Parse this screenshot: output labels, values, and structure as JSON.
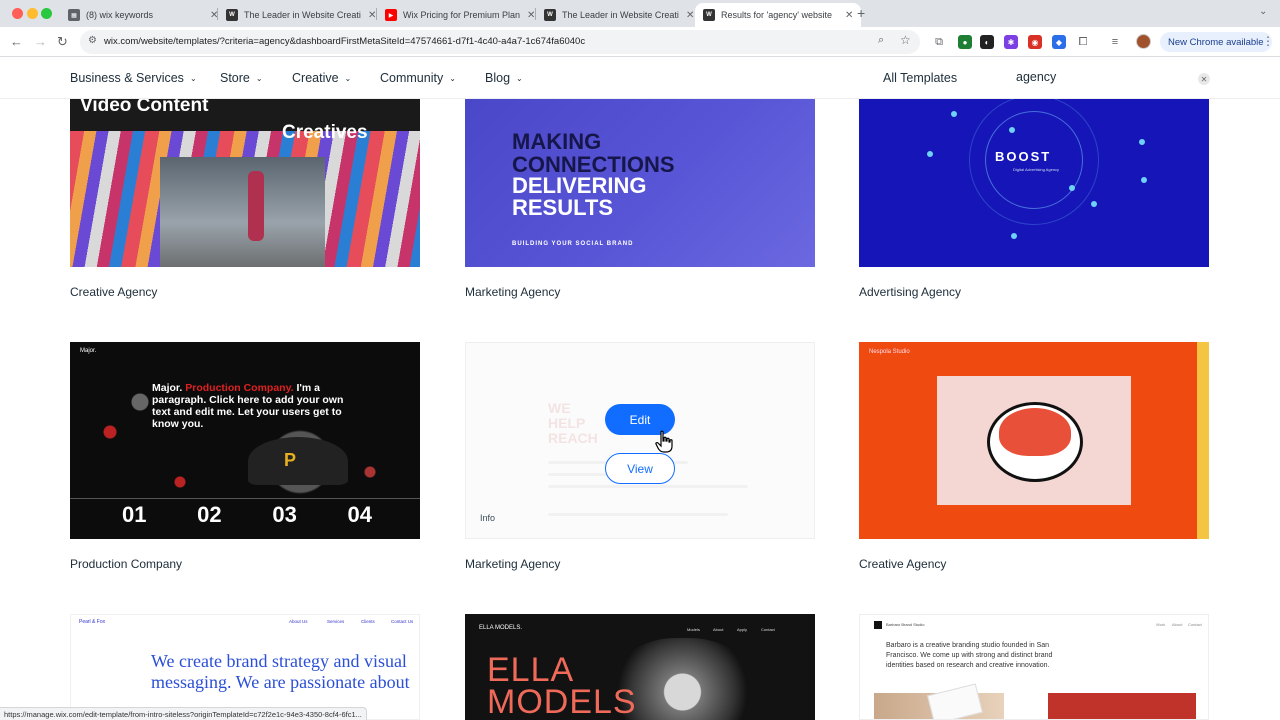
{
  "browser": {
    "tabs": [
      {
        "label": "(8) wix keywords",
        "favicon": "wix-doc-icon"
      },
      {
        "label": "The Leader in Website Creati",
        "favicon": "wix-icon"
      },
      {
        "label": "Wix Pricing for Premium Plan",
        "favicon": "youtube-icon"
      },
      {
        "label": "The Leader in Website Creati",
        "favicon": "wix-icon"
      },
      {
        "label": "Results for 'agency' website",
        "favicon": "wix-icon",
        "active": true
      }
    ],
    "url": "wix.com/website/templates/?criteria=agency&dashboardFirstMetaSiteId=47574661-d7f1-4c40-a4a7-1c674fa6040c",
    "update_label": "New Chrome available",
    "status_url": "https://manage.wix.com/edit-template/from-intro-siteless?originTemplateId=c72f2e1c-94e3-4350-8cf4-6fc1..."
  },
  "nav": {
    "items": [
      {
        "label": "Business & Services"
      },
      {
        "label": "Store"
      },
      {
        "label": "Creative"
      },
      {
        "label": "Community"
      },
      {
        "label": "Blog"
      }
    ],
    "all_templates": "All Templates",
    "search_value": "agency"
  },
  "templates": [
    {
      "title": "Creative Agency",
      "thumb": {
        "line1": "Video Content",
        "line2": "Creatives"
      }
    },
    {
      "title": "Marketing Agency",
      "thumb": {
        "line1": "MAKING",
        "line2": "CONNECTIONS",
        "line3": "DELIVERING",
        "line4": "RESULTS",
        "sub": "BUILDING YOUR SOCIAL BRAND"
      }
    },
    {
      "title": "Advertising Agency",
      "thumb": {
        "logo": "BOOST",
        "sub": "Digital Advertising Agency"
      }
    },
    {
      "title": "Production Company",
      "thumb": {
        "brand": "Major.",
        "para_lead": "Major.",
        "para_red": "Production Company.",
        "para_rest": "I'm a paragraph. Click here to add your own text and edit me. Let your users get to know you.",
        "nums": [
          "01",
          "02",
          "03",
          "04"
        ]
      }
    },
    {
      "title": "Marketing Agency",
      "hover": {
        "edit": "Edit",
        "view": "View",
        "info": "Info"
      }
    },
    {
      "title": "Creative Agency",
      "thumb": {
        "brand": "Nespola Studio"
      }
    },
    {
      "thumb": {
        "brand": "Pearl & Fox",
        "menu": [
          "About Us",
          "Services",
          "Clients",
          "Contact Us"
        ],
        "hero": "We create brand strategy and visual messaging. We are passionate about"
      }
    },
    {
      "thumb": {
        "brand": "ELLA MODELS.",
        "menu": [
          "Models",
          "About",
          "Apply",
          "Contact"
        ],
        "big1": "ELLA",
        "big2": "MODELS"
      }
    },
    {
      "thumb": {
        "brand": "Barbaro Brand Studio",
        "menu": [
          "Work",
          "About",
          "Contact"
        ],
        "desc": "Barbaro is a creative branding studio founded in San Francisco. We come up with strong and distinct brand identities based on research and creative innovation."
      }
    }
  ],
  "colors": {
    "accent": "#116dff",
    "nav_text": "#20303c"
  }
}
